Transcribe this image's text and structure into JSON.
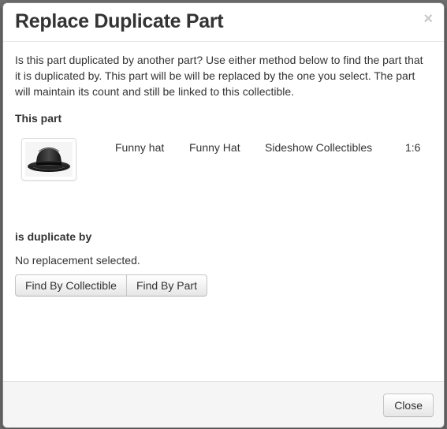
{
  "dialog": {
    "title": "Replace Duplicate Part",
    "close_symbol": "×",
    "intro": "Is this part duplicated by another part? Use either method below to find the part that it is duplicated by. This part will be will be replaced by the one you select. The part will maintain its count and still be linked to this collectible."
  },
  "this_part": {
    "label": "This part",
    "image_icon": "black-fedora-hat-photo",
    "columns": [
      "Funny hat",
      "Funny Hat",
      "Sideshow Collectibles",
      "1:6"
    ]
  },
  "duplicate": {
    "label": "is duplicate by",
    "status": "No replacement selected.",
    "find_by_collectible_label": "Find By Collectible",
    "find_by_part_label": "Find By Part"
  },
  "footer": {
    "close_label": "Close"
  }
}
